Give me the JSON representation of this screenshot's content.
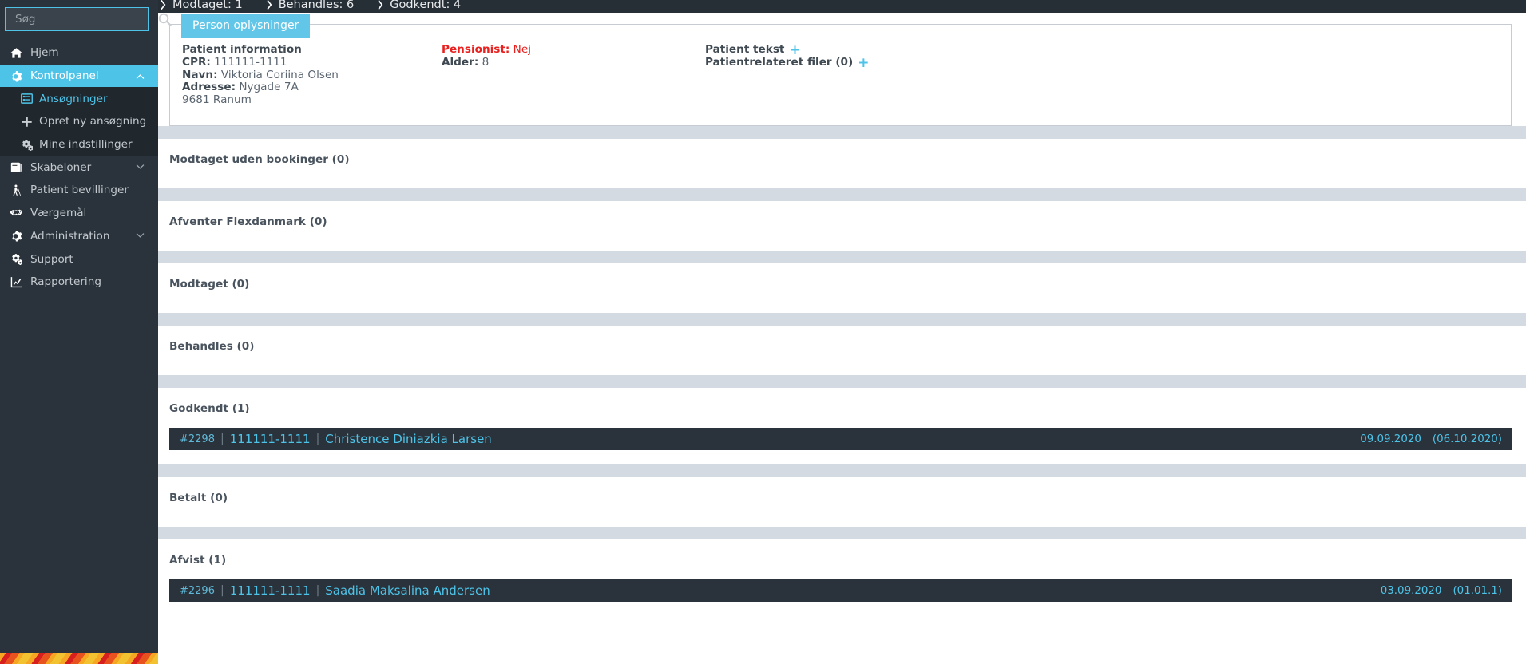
{
  "topbar": {
    "crumbs": [
      {
        "icon": "chevron-right-icon",
        "label": "Modtaget: 1"
      },
      {
        "icon": "chevron-right-icon",
        "label": "Behandles: 6"
      },
      {
        "icon": "chevron-right-icon",
        "label": "Godkendt: 4"
      }
    ]
  },
  "sidebar": {
    "search": {
      "value": "",
      "placeholder": "Søg",
      "icon": "search-icon"
    },
    "items": [
      {
        "icon": "home-icon",
        "label": "Hjem",
        "state": "normal",
        "caret": ""
      },
      {
        "icon": "gear-icon",
        "label": "Kontrolpanel",
        "state": "active",
        "caret": "chevron-up-icon"
      },
      {
        "icon": "list-box-icon",
        "label": "Ansøgninger",
        "state": "sub-current",
        "caret": ""
      },
      {
        "icon": "plus-icon",
        "label": "Opret ny ansøgning",
        "state": "sub",
        "caret": ""
      },
      {
        "icon": "gears-icon",
        "label": "Mine indstillinger",
        "state": "sub",
        "caret": ""
      },
      {
        "icon": "book-icon",
        "label": "Skabeloner",
        "state": "normal",
        "caret": "chevron-down-icon"
      },
      {
        "icon": "blind-person-icon",
        "label": "Patient bevillinger",
        "state": "normal",
        "caret": ""
      },
      {
        "icon": "handshake-icon",
        "label": "Værgemål",
        "state": "normal",
        "caret": ""
      },
      {
        "icon": "gear-icon",
        "label": "Administration",
        "state": "normal",
        "caret": "chevron-down-icon"
      },
      {
        "icon": "gears-icon",
        "label": "Support",
        "state": "normal",
        "caret": ""
      },
      {
        "icon": "chart-line-icon",
        "label": "Rapportering",
        "state": "normal",
        "caret": ""
      }
    ]
  },
  "person_panel": {
    "tab_label": "Person oplysninger",
    "col_a": {
      "heading": "Patient information",
      "cpr_label": "CPR:",
      "cpr_value": "111111-1111",
      "navn_label": "Navn:",
      "navn_value": "Viktoria Coriina Olsen",
      "adresse_label": "Adresse:",
      "adresse_value": "Nygade 7A",
      "adresse_line2": "9681 Ranum"
    },
    "col_b": {
      "pensionist_label": "Pensionist:",
      "pensionist_value": "Nej",
      "alder_label": "Alder:",
      "alder_value": "8"
    },
    "col_c": {
      "patient_tekst_label": "Patient tekst",
      "patient_tekst_add": "+",
      "filer_label": "Patientrelateret filer (0)",
      "filer_add": "+"
    }
  },
  "sections": [
    {
      "title": "Modtaget uden bookinger",
      "count": "(0)",
      "records": []
    },
    {
      "title": "Afventer Flexdanmark",
      "count": "(0)",
      "records": []
    },
    {
      "title": "Modtaget",
      "count": "(0)",
      "records": []
    },
    {
      "title": "Behandles",
      "count": "(0)",
      "records": []
    },
    {
      "title": "Godkendt",
      "count": "(1)",
      "records": [
        {
          "id": "#2298",
          "cpr": "111111-1111",
          "name": "Christence Diniazkia Larsen",
          "date1": "09.09.2020",
          "date2": "(06.10.2020)"
        }
      ]
    },
    {
      "title": "Betalt",
      "count": "(0)",
      "records": []
    },
    {
      "title": "Afvist",
      "count": "(1)",
      "records": [
        {
          "id": "#2296",
          "cpr": "111111-1111",
          "name": "Saadia Maksalina Andersen",
          "date1": "03.09.2020",
          "date2": "(01.01.1)"
        }
      ]
    }
  ],
  "colors": {
    "accent": "#4ec3e8",
    "sidebar_bg": "#2a333b",
    "sidebar_sub_bg": "#20282e",
    "separator": "#d3dae1",
    "danger": "#e8211f",
    "record_bg": "#2a333b"
  }
}
